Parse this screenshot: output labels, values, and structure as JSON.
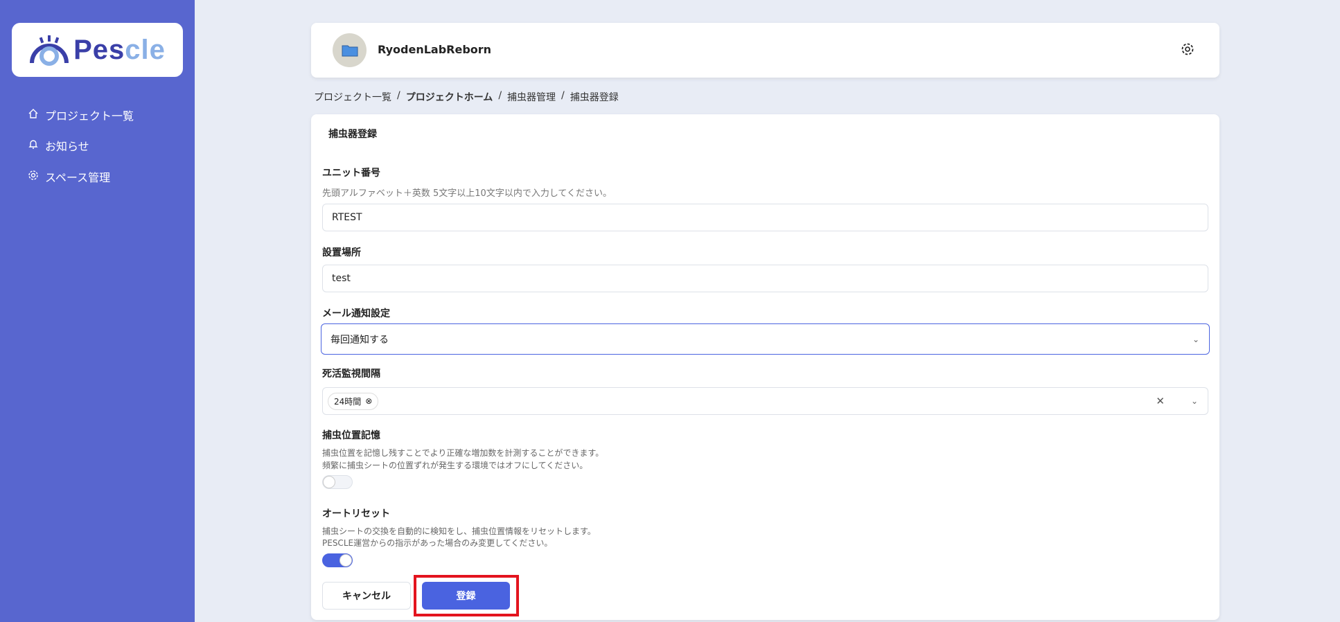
{
  "sidebar": {
    "logo": "Pescle",
    "items": [
      {
        "label": "プロジェクト一覧",
        "icon": "home-icon"
      },
      {
        "label": "お知らせ",
        "icon": "bell-icon"
      },
      {
        "label": "スペース管理",
        "icon": "gear-icon"
      }
    ]
  },
  "header": {
    "project_name": "RyodenLabReborn"
  },
  "breadcrumb": [
    "プロジェクト一覧",
    "プロジェクトホーム",
    "捕虫器管理",
    "捕虫器登録"
  ],
  "form": {
    "title": "捕虫器登録",
    "unit_label": "ユニット番号",
    "unit_hint": "先頭アルファベット＋英数 5文字以上10文字以内で入力してください。",
    "unit_value": "RTEST",
    "location_label": "設置場所",
    "location_value": "test",
    "mail_label": "メール通知設定",
    "mail_value": "毎回通知する",
    "alive_label": "死活監視間隔",
    "alive_chip": "24時間",
    "position_label": "捕虫位置記憶",
    "position_desc1": "捕虫位置を記憶し残すことでより正確な増加数を計測することができます。",
    "position_desc2": "頻繁に捕虫シートの位置ずれが発生する環境ではオフにしてください。",
    "position_on": false,
    "reset_label": "オートリセット",
    "reset_desc1": "捕虫シートの交換を自動的に検知をし、捕虫位置情報をリセットします。",
    "reset_desc2": "PESCLE運営からの指示があった場合のみ変更してください。",
    "reset_on": true,
    "cancel": "キャンセル",
    "submit": "登録"
  },
  "colors": {
    "sidebar": "#5866cf",
    "accent": "#4a63e0",
    "highlight": "#e3141e"
  }
}
